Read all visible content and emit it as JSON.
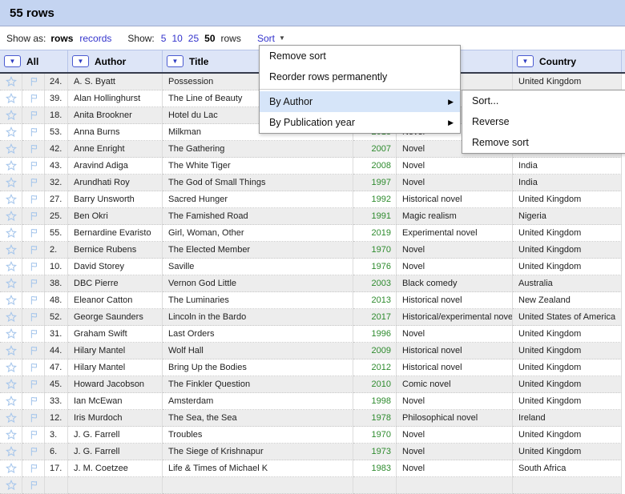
{
  "header": {
    "title": "55 rows"
  },
  "toolbar": {
    "show_as_label": "Show as:",
    "show_as_options": [
      {
        "label": "rows",
        "active": true
      },
      {
        "label": "records",
        "active": false
      }
    ],
    "show_label": "Show:",
    "page_sizes": [
      {
        "label": "5",
        "active": false
      },
      {
        "label": "10",
        "active": false
      },
      {
        "label": "25",
        "active": false
      },
      {
        "label": "50",
        "active": true
      }
    ],
    "rows_suffix": "rows",
    "sort_label": "Sort"
  },
  "menu": {
    "items": [
      "Remove sort",
      "Reorder rows permanently"
    ],
    "column_items": [
      {
        "label": "By Author",
        "highlighted": true
      },
      {
        "label": "By Publication year",
        "highlighted": false
      }
    ],
    "submenu": [
      "Sort...",
      "Reverse",
      "Remove sort"
    ]
  },
  "table": {
    "headers": [
      {
        "label": "All"
      },
      {
        "label": "Author"
      },
      {
        "label": "Title"
      },
      {
        "label": ""
      },
      {
        "label": ""
      },
      {
        "label": "Country"
      }
    ],
    "rows": [
      {
        "num": "24.",
        "author": "A. S. Byatt",
        "title": "Possession",
        "year": "",
        "genre": "",
        "country": "United Kingdom"
      },
      {
        "num": "39.",
        "author": "Alan Hollinghurst",
        "title": "The Line of Beauty",
        "year": "",
        "genre": "",
        "country": ""
      },
      {
        "num": "18.",
        "author": "Anita Brookner",
        "title": "Hotel du Lac",
        "year": "",
        "genre": "",
        "country": ""
      },
      {
        "num": "53.",
        "author": "Anna Burns",
        "title": "Milkman",
        "year": "2018",
        "genre": "Novel",
        "country": ""
      },
      {
        "num": "42.",
        "author": "Anne Enright",
        "title": "The Gathering",
        "year": "2007",
        "genre": "Novel",
        "country": ""
      },
      {
        "num": "43.",
        "author": "Aravind Adiga",
        "title": "The White Tiger",
        "year": "2008",
        "genre": "Novel",
        "country": "India"
      },
      {
        "num": "32.",
        "author": "Arundhati Roy",
        "title": "The God of Small Things",
        "year": "1997",
        "genre": "Novel",
        "country": "India"
      },
      {
        "num": "27.",
        "author": "Barry Unsworth",
        "title": "Sacred Hunger",
        "year": "1992",
        "genre": "Historical novel",
        "country": "United Kingdom"
      },
      {
        "num": "25.",
        "author": "Ben Okri",
        "title": "The Famished Road",
        "year": "1991",
        "genre": "Magic realism",
        "country": "Nigeria"
      },
      {
        "num": "55.",
        "author": "Bernardine Evaristo",
        "title": "Girl, Woman, Other",
        "year": "2019",
        "genre": "Experimental novel",
        "country": "United Kingdom"
      },
      {
        "num": "2.",
        "author": "Bernice Rubens",
        "title": "The Elected Member",
        "year": "1970",
        "genre": "Novel",
        "country": "United Kingdom"
      },
      {
        "num": "10.",
        "author": "David Storey",
        "title": "Saville",
        "year": "1976",
        "genre": "Novel",
        "country": "United Kingdom"
      },
      {
        "num": "38.",
        "author": "DBC Pierre",
        "title": "Vernon God Little",
        "year": "2003",
        "genre": "Black comedy",
        "country": "Australia"
      },
      {
        "num": "48.",
        "author": "Eleanor Catton",
        "title": "The Luminaries",
        "year": "2013",
        "genre": "Historical novel",
        "country": "New Zealand"
      },
      {
        "num": "52.",
        "author": "George Saunders",
        "title": "Lincoln in the Bardo",
        "year": "2017",
        "genre": "Historical/experimental novel",
        "country": "United States of America"
      },
      {
        "num": "31.",
        "author": "Graham Swift",
        "title": "Last Orders",
        "year": "1996",
        "genre": "Novel",
        "country": "United Kingdom"
      },
      {
        "num": "44.",
        "author": "Hilary Mantel",
        "title": "Wolf Hall",
        "year": "2009",
        "genre": "Historical novel",
        "country": "United Kingdom"
      },
      {
        "num": "47.",
        "author": "Hilary Mantel",
        "title": "Bring Up the Bodies",
        "year": "2012",
        "genre": "Historical novel",
        "country": "United Kingdom"
      },
      {
        "num": "45.",
        "author": "Howard Jacobson",
        "title": "The Finkler Question",
        "year": "2010",
        "genre": "Comic novel",
        "country": "United Kingdom"
      },
      {
        "num": "33.",
        "author": "Ian McEwan",
        "title": "Amsterdam",
        "year": "1998",
        "genre": "Novel",
        "country": "United Kingdom"
      },
      {
        "num": "12.",
        "author": "Iris Murdoch",
        "title": "The Sea, the Sea",
        "year": "1978",
        "genre": "Philosophical novel",
        "country": "Ireland"
      },
      {
        "num": "3.",
        "author": "J. G. Farrell",
        "title": "Troubles",
        "year": "1970",
        "genre": "Novel",
        "country": "United Kingdom"
      },
      {
        "num": "6.",
        "author": "J. G. Farrell",
        "title": "The Siege of Krishnapur",
        "year": "1973",
        "genre": "Novel",
        "country": "United Kingdom"
      },
      {
        "num": "17.",
        "author": "J. M. Coetzee",
        "title": "Life & Times of Michael K",
        "year": "1983",
        "genre": "Novel",
        "country": "South Africa"
      },
      {
        "num": "",
        "author": "",
        "title": "",
        "year": "",
        "genre": "",
        "country": ""
      }
    ]
  },
  "colors": {
    "topbar_bg": "#c4d4f1",
    "topbar_border": "#9fabcd",
    "link": "#3333cc",
    "year_green": "#2e8b2e",
    "header_bg": "#dde5f7",
    "header_sep": "#b7c4e8",
    "header_border_dark": "#363c4d",
    "row_alt": "#ededed",
    "cell_border": "#dcdcdc",
    "row_border": "#c9c9c9",
    "menu_border": "#999999",
    "menu_highlight": "#d6e5f9",
    "icon_blue": "#a6c6ec",
    "button_border": "#4a5ad0",
    "button_arrow": "#2d3bc0"
  }
}
